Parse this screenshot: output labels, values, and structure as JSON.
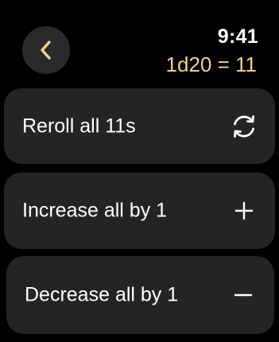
{
  "status": {
    "time": "9:41",
    "roll_result": "1d20 = 11"
  },
  "nav": {
    "back_icon": "chevron-left-icon"
  },
  "actions": [
    {
      "label": "Reroll all 11s",
      "icon": "arrow-cycle-icon"
    },
    {
      "label": "Increase all by 1",
      "icon": "plus-icon"
    },
    {
      "label": "Decrease all by 1",
      "icon": "minus-icon"
    }
  ],
  "colors": {
    "background": "#000000",
    "card": "#242426",
    "accent": "#f3d386",
    "text": "#ffffff"
  }
}
